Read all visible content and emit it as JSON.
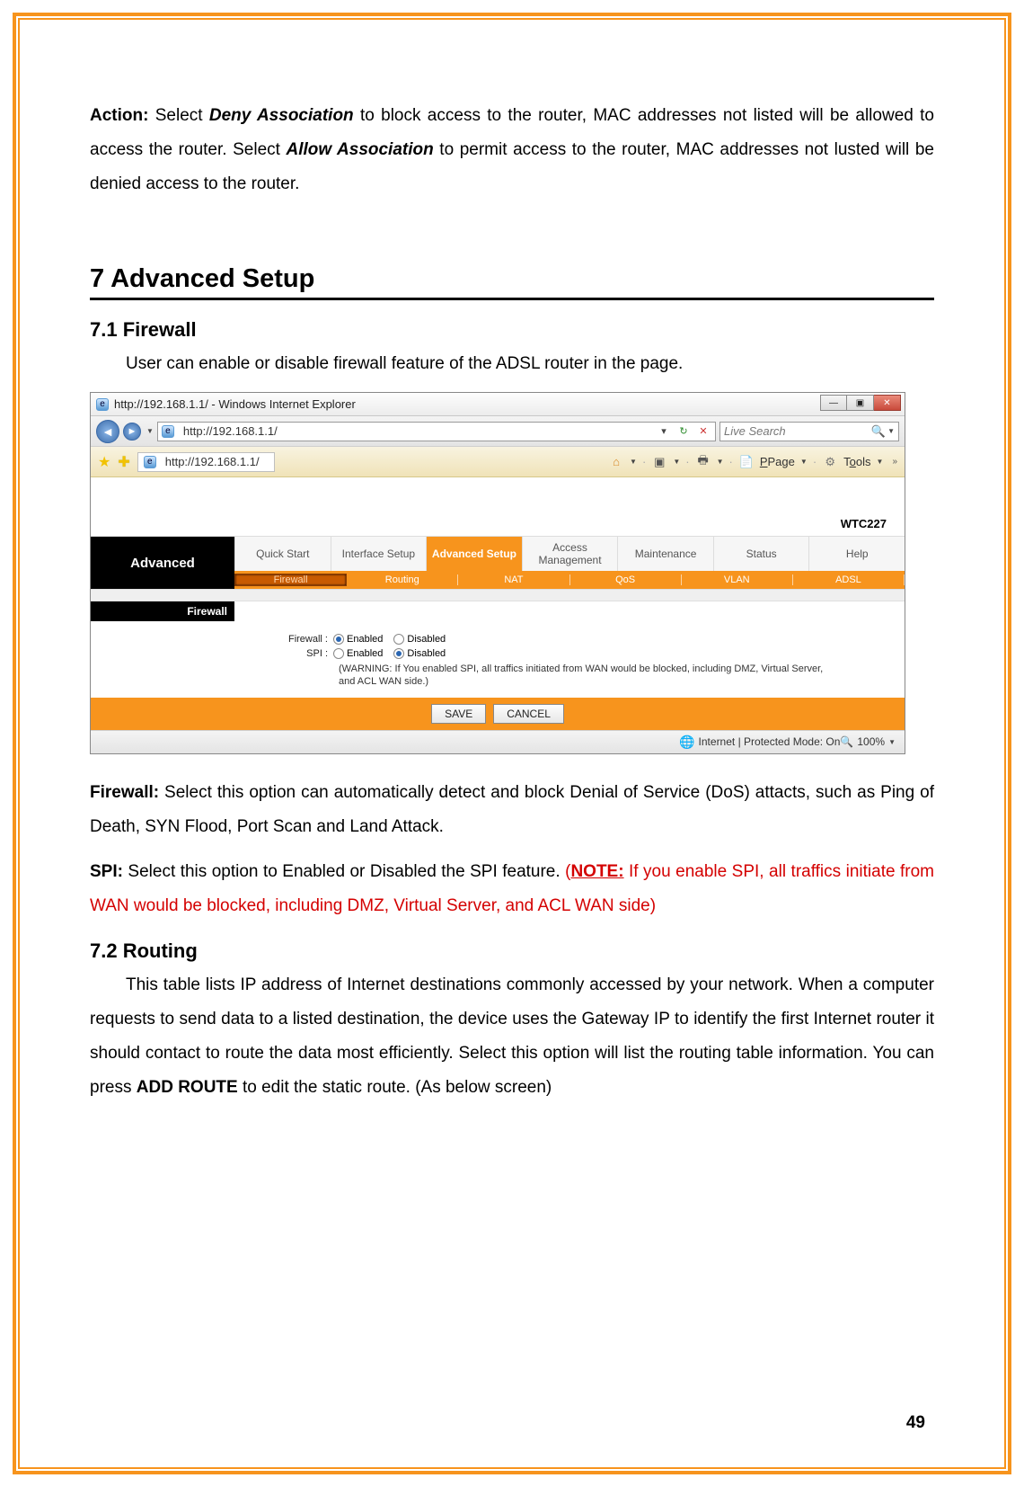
{
  "doc": {
    "action_p1a": "Action:",
    "action_p1b": " Select ",
    "action_p1c": "Deny Association",
    "action_p1d": " to block access to the router, MAC addresses not listed will be allowed to access the router. Select ",
    "action_p1e": "Allow Association",
    "action_p1f": " to permit access to the router, MAC addresses not lusted will be denied access to the router.",
    "h7": "7 Advanced Setup",
    "h71": "7.1 Firewall",
    "p71": "User can enable or disable firewall feature of the ADSL router in the page.",
    "fw_a": "Firewall:",
    "fw_b": " Select this option can automatically detect and block Denial of Service (DoS) attacts, such as Ping of Death, SYN Flood, Port Scan and Land Attack.",
    "spi_a": "SPI:",
    "spi_b": " Select this option to Enabled or Disabled the SPI feature. ",
    "spi_c1": "(",
    "spi_c2": "NOTE:",
    "spi_c3": " If you enable SPI, all traffics initiate from WAN would be blocked, including DMZ, Virtual Server, and ACL WAN side)",
    "h72": "7.2 Routing",
    "p72a": "This table lists IP address of Internet destinations commonly accessed by your network. When a computer requests to send data to a listed destination, the device uses the Gateway IP to identify the first Internet router it should contact to route the data most efficiently. Select this option will list the routing table information. You can press ",
    "p72b": "ADD ROUTE",
    "p72c": " to edit the static route. (As below screen)",
    "page_num": "49"
  },
  "ie": {
    "title": "http://192.168.1.1/ - Windows Internet Explorer",
    "url": "http://192.168.1.1/",
    "tab_url": "http://192.168.1.1/",
    "search_placeholder": "Live Search",
    "toolbar_page": "Page",
    "toolbar_tools": "Tools",
    "status": "Internet | Protected Mode: On",
    "zoom": "100%"
  },
  "router": {
    "model": "WTC227",
    "side_label": "Advanced",
    "tabs": [
      "Quick Start",
      "Interface Setup",
      "Advanced Setup",
      "Access Management",
      "Maintenance",
      "Status",
      "Help"
    ],
    "subtabs": [
      "Firewall",
      "Routing",
      "NAT",
      "QoS",
      "VLAN",
      "ADSL"
    ],
    "section_label": "Firewall",
    "firewall_label": "Firewall :",
    "spi_label": "SPI :",
    "opt_enabled": "Enabled",
    "opt_disabled": "Disabled",
    "spi_warning": "(WARNING: If You enabled SPI, all traffics initiated from WAN would be blocked, including DMZ, Virtual Server, and ACL WAN side.)",
    "btn_save": "SAVE",
    "btn_cancel": "CANCEL"
  }
}
